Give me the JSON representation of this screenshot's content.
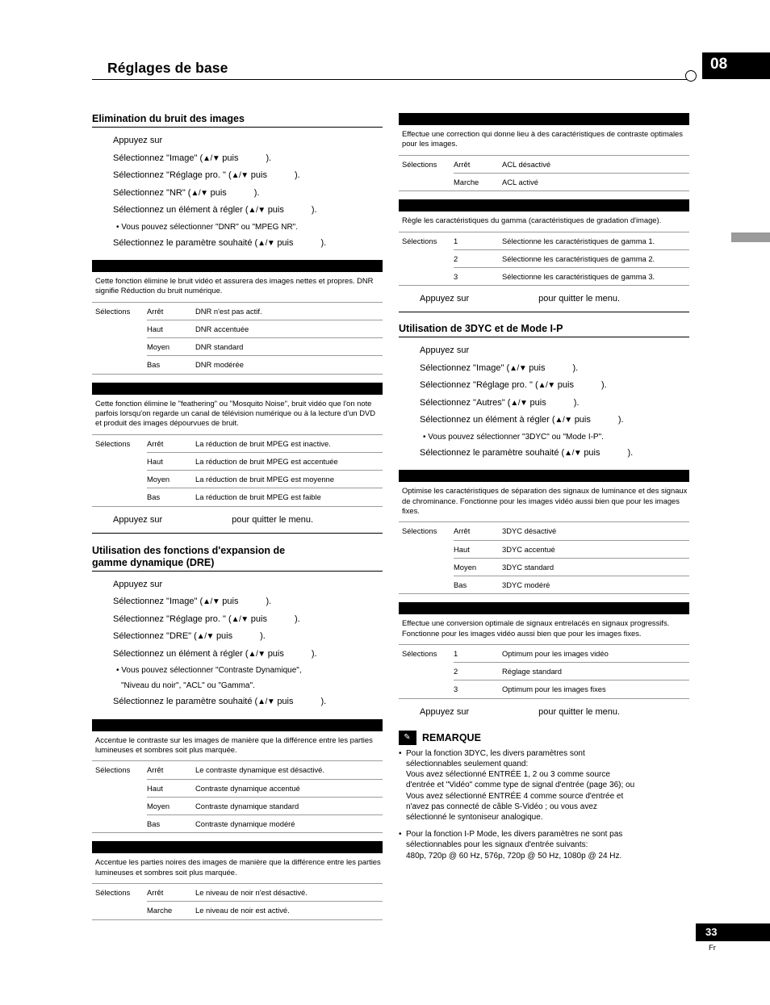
{
  "header": {
    "title": "Réglages de base",
    "chapter": "08"
  },
  "footer": {
    "page": "33",
    "lang": "Fr"
  },
  "left": {
    "section1": {
      "title": "Elimination du bruit des images",
      "steps": [
        "Appuyez sur",
        "Sélectionnez \"Image\" (",
        "Sélectionnez \"Réglage pro. \" (",
        "Sélectionnez \"NR\" (",
        "Sélectionnez un élément à régler (",
        "• Vous pouvez sélectionner \"DNR\" ou \"MPEG NR\".",
        "Sélectionnez le paramètre souhaité ("
      ],
      "step_labels": {
        "s1": "Appuyez sur",
        "s2_pre": "Sélectionnez \"Image\" (",
        "s2_mid": "puis",
        "s2_end": ").",
        "s3_pre": "Sélectionnez \"Réglage pro. \" (",
        "s4_pre": "Sélectionnez \"NR\" (",
        "s5_pre": "Sélectionnez un élément à régler (",
        "s6": "• Vous pouvez sélectionner \"DNR\" ou \"MPEG NR\".",
        "s7_pre": "Sélectionnez le paramètre souhaité ("
      },
      "table1": {
        "desc": "Cette fonction élimine le bruit vidéo et assurera des images nettes et propres. DNR signifie Réduction du bruit numérique.",
        "col1": "Sélections",
        "rows": [
          {
            "opt": "Arrêt",
            "txt": "DNR n'est pas actif."
          },
          {
            "opt": "Haut",
            "txt": "DNR accentuée"
          },
          {
            "opt": "Moyen",
            "txt": "DNR standard"
          },
          {
            "opt": "Bas",
            "txt": "DNR modérée"
          }
        ]
      },
      "table2": {
        "desc": "Cette fonction élimine le \"feathering\" ou \"Mosquito Noise\", bruit vidéo que l'on note parfois lorsqu'on regarde un canal de télévision numérique ou à la lecture d'un DVD et produit des images dépourvues de bruit.",
        "col1": "Sélections",
        "rows": [
          {
            "opt": "Arrêt",
            "txt": "La réduction de bruit MPEG est inactive."
          },
          {
            "opt": "Haut",
            "txt": "La réduction de bruit MPEG est accentuée"
          },
          {
            "opt": "Moyen",
            "txt": "La réduction de bruit MPEG est moyenne"
          },
          {
            "opt": "Bas",
            "txt": "La réduction de bruit MPEG est faible"
          }
        ]
      },
      "exit_pre": "Appuyez sur",
      "exit_post": "pour quitter le menu."
    },
    "section2": {
      "title_line1": "Utilisation des fonctions d'expansion de",
      "title_line2": "gamme dynamique (DRE)",
      "steps": {
        "s1": "Appuyez sur",
        "s2_pre": "Sélectionnez \"Image\" (",
        "s3_pre": "Sélectionnez \"Réglage pro. \" (",
        "s4_pre": "Sélectionnez \"DRE\" (",
        "s5_pre": "Sélectionnez un élément à régler (",
        "s6_line1": "• Vous pouvez sélectionner \"Contraste Dynamique\",",
        "s6_line2": "\"Niveau du noir\", \"ACL\" ou \"Gamma\".",
        "s7_pre": "Sélectionnez le paramètre souhaité (",
        "mid": "puis",
        "end": ")."
      },
      "table1": {
        "desc": "Accentue le contraste sur les images de manière que la différence entre les parties lumineuses et sombres soit plus marquée.",
        "col1": "Sélections",
        "rows": [
          {
            "opt": "Arrêt",
            "txt": "Le contraste dynamique est désactivé."
          },
          {
            "opt": "Haut",
            "txt": "Contraste dynamique accentué"
          },
          {
            "opt": "Moyen",
            "txt": "Contraste dynamique standard"
          },
          {
            "opt": "Bas",
            "txt": "Contraste dynamique modéré"
          }
        ]
      },
      "table2": {
        "desc": "Accentue les parties noires des images de manière que la différence entre les parties lumineuses et sombres soit plus marquée.",
        "col1": "Sélections",
        "rows": [
          {
            "opt": "Arrêt",
            "txt": "Le niveau de noir n'est désactivé."
          },
          {
            "opt": "Marche",
            "txt": "Le niveau de noir est activé."
          }
        ]
      }
    }
  },
  "right": {
    "table_acl": {
      "desc": "Effectue une correction qui donne lieu à des caractéristiques de contraste optimales pour les images.",
      "col1": "Sélections",
      "rows": [
        {
          "opt": "Arrêt",
          "txt": "ACL désactivé"
        },
        {
          "opt": "Marche",
          "txt": "ACL activé"
        }
      ]
    },
    "table_gamma": {
      "desc": "Règle les caractéristiques du gamma (caractéristiques de gradation d'image).",
      "col1": "Sélections",
      "rows": [
        {
          "opt": "1",
          "txt": "Sélectionne les caractéristiques de gamma 1."
        },
        {
          "opt": "2",
          "txt": "Sélectionne les caractéristiques de gamma 2."
        },
        {
          "opt": "3",
          "txt": "Sélectionne les caractéristiques de gamma 3."
        }
      ]
    },
    "exit1_pre": "Appuyez sur",
    "exit1_post": "pour quitter le menu.",
    "section": {
      "title": "Utilisation de 3DYC et de Mode I-P",
      "steps": {
        "s1": "Appuyez sur",
        "s2_pre": "Sélectionnez \"Image\" (",
        "s3_pre": "Sélectionnez \"Réglage pro. \" (",
        "s4_pre": "Sélectionnez \"Autres\" (",
        "s5_pre": "Sélectionnez un élément à régler (",
        "s6": "• Vous pouvez sélectionner \"3DYC\" ou \"Mode I-P\".",
        "s7_pre": "Sélectionnez le paramètre souhaité (",
        "mid": "puis",
        "end": ")."
      },
      "table_3dyc": {
        "desc": "Optimise les caractéristiques de séparation des signaux de luminance et des signaux de chrominance. Fonctionne pour les images vidéo aussi bien que pour les images fixes.",
        "col1": "Sélections",
        "rows": [
          {
            "opt": "Arrêt",
            "txt": "3DYC désactivé"
          },
          {
            "opt": "Haut",
            "txt": "3DYC accentué"
          },
          {
            "opt": "Moyen",
            "txt": "3DYC standard"
          },
          {
            "opt": "Bas",
            "txt": "3DYC modéré"
          }
        ]
      },
      "table_ip": {
        "desc": "Effectue une conversion optimale de signaux entrelacés en signaux progressifs. Fonctionne pour les images vidéo aussi bien que pour les images fixes.",
        "col1": "Sélections",
        "rows": [
          {
            "opt": "1",
            "txt": "Optimum pour les images vidéo"
          },
          {
            "opt": "2",
            "txt": "Réglage standard"
          },
          {
            "opt": "3",
            "txt": "Optimum pour les images fixes"
          }
        ]
      },
      "exit2_pre": "Appuyez sur",
      "exit2_post": "pour quitter le menu."
    },
    "remarque": {
      "title": "REMARQUE",
      "notes": [
        "Pour la fonction 3DYC, les divers paramètres sont sélectionnables seulement quand: Vous avez sélectionné ENTRÉE 1, 2 ou 3 comme source d'entrée et \"Vidéo\" comme type de signal d'entrée (page 36); ou Vous avez sélectionné ENTRÉE 4 comme source d'entrée et n'avez pas connecté de câble S-Vidéo ; ou vous avez sélectionné le syntoniseur analogique.",
        "Pour la fonction I-P Mode, les divers paramètres ne sont pas sélectionnables pour les signaux d'entrée suivants: 480p, 720p @ 60 Hz, 576p, 720p @ 50 Hz, 1080p @ 24 Hz."
      ],
      "note1_lines": [
        "Pour la fonction 3DYC, les divers paramètres sont",
        "sélectionnables seulement quand:",
        "Vous avez sélectionné ENTRÉE 1, 2 ou 3 comme source",
        "d'entrée et \"Vidéo\" comme type de signal d'entrée (page 36); ou",
        "Vous avez sélectionné ENTRÉE 4 comme source d'entrée et",
        "n'avez pas connecté de câble S-Vidéo ; ou vous avez",
        "sélectionné le syntoniseur analogique."
      ],
      "note2_lines": [
        "Pour la fonction I-P Mode, les divers paramètres ne sont pas",
        "sélectionnables pour les signaux d'entrée suivants:",
        "480p, 720p @ 60 Hz, 576p, 720p @ 50 Hz, 1080p @ 24 Hz."
      ]
    }
  },
  "icons": {
    "up_down": "▲/▼",
    "pencil": "✎"
  }
}
